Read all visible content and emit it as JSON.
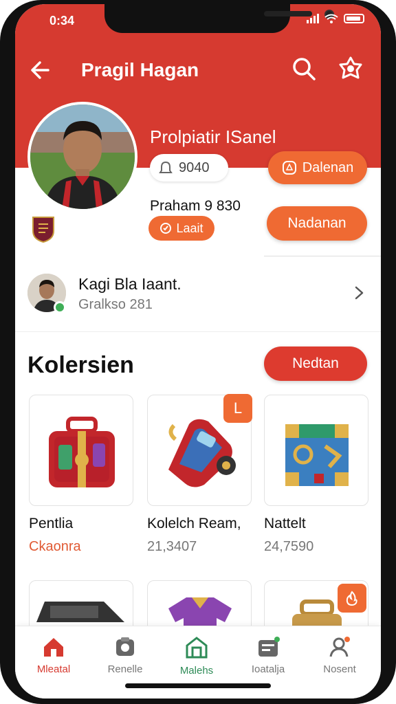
{
  "status": {
    "time": "0:34"
  },
  "header": {
    "title": "Pragil Hagan"
  },
  "profile": {
    "name": "Prolpiatir ISanel",
    "followers": "9040",
    "follow_label": "Dalenan",
    "stat_line": "Praham 9 830",
    "like_label": "Laait",
    "message_label": "Nadanan"
  },
  "contact": {
    "name": "Kagi Bla Iaant.",
    "subtitle": "Gralkso 281"
  },
  "collection": {
    "title": "Kolersien",
    "see_all_label": "Nedtan",
    "items": [
      {
        "name": "Pentlia",
        "price": "Ckaonra",
        "price_color": "#e05a34"
      },
      {
        "name": "Kolelch Ream,",
        "price": "21,3407",
        "tag": "L"
      },
      {
        "name": "Nattelt",
        "price": "24,7590"
      }
    ]
  },
  "nav": {
    "items": [
      {
        "label": "Mleatal",
        "active": true,
        "color": "#d63a30",
        "icon": "home-icon"
      },
      {
        "label": "Renelle",
        "icon": "shop-icon"
      },
      {
        "label": "Malehs",
        "color": "#2e8b57",
        "icon": "store-icon"
      },
      {
        "label": "Ioatalja",
        "icon": "inbox-icon"
      },
      {
        "label": "Nosent",
        "icon": "profile-icon"
      }
    ]
  },
  "colors": {
    "brand_red": "#d63a30",
    "accent_orange": "#ef6a33",
    "online_green": "#3fae57"
  }
}
